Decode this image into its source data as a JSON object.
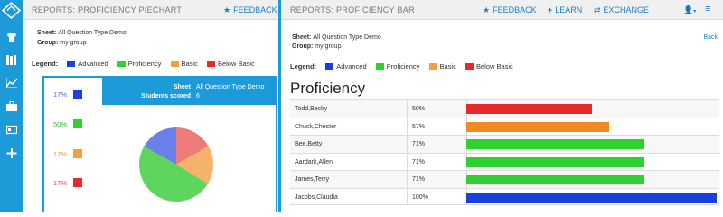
{
  "left_panel": {
    "title": "REPORTS: PROFICIENCY PIECHART",
    "feedback_label": "FEEDBACK",
    "sheet_label": "Sheet:",
    "sheet_value": "All Question Type Demo",
    "group_label": "Group:",
    "group_value": "my group",
    "legend_title": "Legend:",
    "legend": [
      {
        "label": "Advanced",
        "color": "#1a3fe0"
      },
      {
        "label": "Proficiency",
        "color": "#2ed12e"
      },
      {
        "label": "Basic",
        "color": "#f4a03a"
      },
      {
        "label": "Below Basic",
        "color": "#e52a2a"
      }
    ],
    "pie_header": {
      "sheet_key": "Sheet",
      "sheet_value": "All Question Type Demo",
      "students_key": "Students scored",
      "students_value": "6"
    },
    "percents": [
      {
        "text": "17%",
        "color": "#1a3fe0",
        "text_color": "#4f6ed8"
      },
      {
        "text": "50%",
        "color": "#2ed12e",
        "text_color": "#3fae3f"
      },
      {
        "text": "17%",
        "color": "#f4a03a",
        "text_color": "#e79a40"
      },
      {
        "text": "17%",
        "color": "#e52a2a",
        "text_color": "#e05050"
      }
    ]
  },
  "right_panel": {
    "title": "REPORTS: PROFICIENCY BAR",
    "links": {
      "feedback": "FEEDBACK",
      "learn": "LEARN",
      "exchange": "EXCHANGE"
    },
    "sheet_label": "Sheet:",
    "sheet_value": "All Question Type Demo",
    "group_label": "Group:",
    "group_value": "my group",
    "back_label": "Back",
    "legend_title": "Legend:",
    "legend": [
      {
        "label": "Advanced",
        "color": "#1a3fe0"
      },
      {
        "label": "Proficiency",
        "color": "#2ed12e"
      },
      {
        "label": "Basic",
        "color": "#f4a03a"
      },
      {
        "label": "Below Basic",
        "color": "#e52a2a"
      }
    ],
    "heading": "Proficiency",
    "rows": [
      {
        "name": "Todd,Becky",
        "pct": "50%",
        "value": 50,
        "color": "#e52a2a"
      },
      {
        "name": "Chuck,Chester",
        "pct": "57%",
        "value": 57,
        "color": "#f08a22"
      },
      {
        "name": "Bee,Betty",
        "pct": "71%",
        "value": 71,
        "color": "#2ed12e"
      },
      {
        "name": "Aardark,Allen",
        "pct": "71%",
        "value": 71,
        "color": "#2ed12e"
      },
      {
        "name": "James,Terry",
        "pct": "71%",
        "value": 71,
        "color": "#2ed12e"
      },
      {
        "name": "Jacobs,Claudia",
        "pct": "100%",
        "value": 100,
        "color": "#1a3fe0"
      }
    ]
  },
  "chart_data": [
    {
      "type": "pie",
      "categories": [
        "Advanced",
        "Proficiency",
        "Basic",
        "Below Basic"
      ],
      "values": [
        17,
        50,
        17,
        17
      ],
      "colors": [
        "#6a7fe8",
        "#5ed65e",
        "#f5b26a",
        "#ee7a7a"
      ]
    },
    {
      "type": "bar",
      "categories": [
        "Todd,Becky",
        "Chuck,Chester",
        "Bee,Betty",
        "Aardark,Allen",
        "James,Terry",
        "Jacobs,Claudia"
      ],
      "values": [
        50,
        57,
        71,
        71,
        71,
        100
      ]
    }
  ]
}
